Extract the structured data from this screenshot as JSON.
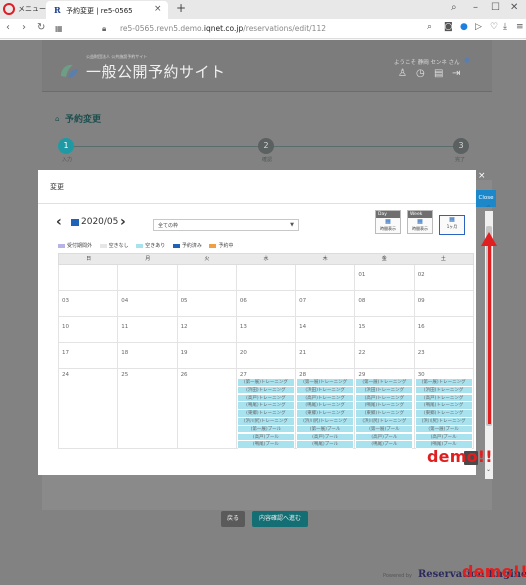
{
  "browser": {
    "menu_label": "メニュー",
    "tab_favicon": "R",
    "tab_title": "予約変更 | re5-0565",
    "tab_close": "×",
    "new_tab": "+",
    "url_prefix": "re5-0565.revn5.demo.",
    "url_domain": "iqnet.co.jp",
    "url_path": "/reservations/edit/112"
  },
  "header": {
    "site_subtitle": "公益財団法人 公共施設予約サイト",
    "site_title": "一般公開予約サイト",
    "welcome": "ようこそ 静岡 センネ さん"
  },
  "breadcrumb": {
    "title": "予約変更"
  },
  "steps": [
    {
      "num": "1",
      "label": "入力"
    },
    {
      "num": "2",
      "label": "確認"
    },
    {
      "num": "3",
      "label": "完了"
    }
  ],
  "buttons": {
    "back": "戻る",
    "next": "内容確認へ進む"
  },
  "powered_by": "Powered by",
  "powered_logo": "Reservation Engine",
  "demo_label": "demo!!",
  "modal": {
    "title": "変更",
    "close_x": "×",
    "close_label": "Close",
    "month": "2020/05",
    "facility_placeholder": "全ての枠",
    "views": [
      {
        "head": "Day",
        "label": "時間表示"
      },
      {
        "head": "Week",
        "label": "時間表示"
      },
      {
        "head": "",
        "label": "1ヶ月"
      }
    ],
    "legend": [
      {
        "label": "受付期間外",
        "color": "#b8b3e6"
      },
      {
        "label": "空きなし",
        "color": "#e6e6e6"
      },
      {
        "label": "空きあり",
        "color": "#a9e2ef"
      },
      {
        "label": "予約済み",
        "color": "#1e63b8"
      },
      {
        "label": "予約中",
        "color": "#f0a040"
      }
    ],
    "weekdays": [
      "日",
      "月",
      "火",
      "水",
      "木",
      "金",
      "土"
    ],
    "weeks": [
      [
        "",
        "",
        "",
        "",
        "",
        "01",
        "02"
      ],
      [
        "03",
        "04",
        "05",
        "06",
        "07",
        "08",
        "09"
      ],
      [
        "10",
        "11",
        "12",
        "13",
        "14",
        "15",
        "16"
      ],
      [
        "17",
        "18",
        "19",
        "20",
        "21",
        "22",
        "23"
      ],
      [
        "24",
        "25",
        "26",
        "27",
        "28",
        "29",
        "30"
      ]
    ],
    "slot_labels": [
      "(第一展)トレーニング",
      "(浜田)トレーニング",
      "(高戸)トレーニング",
      "(鳴尾)トレーニング",
      "(東郷)トレーニング",
      "(浜川尻)トレーニング",
      "(第一展)プール",
      "(高戸)プール",
      "(鳴尾)プール"
    ]
  }
}
